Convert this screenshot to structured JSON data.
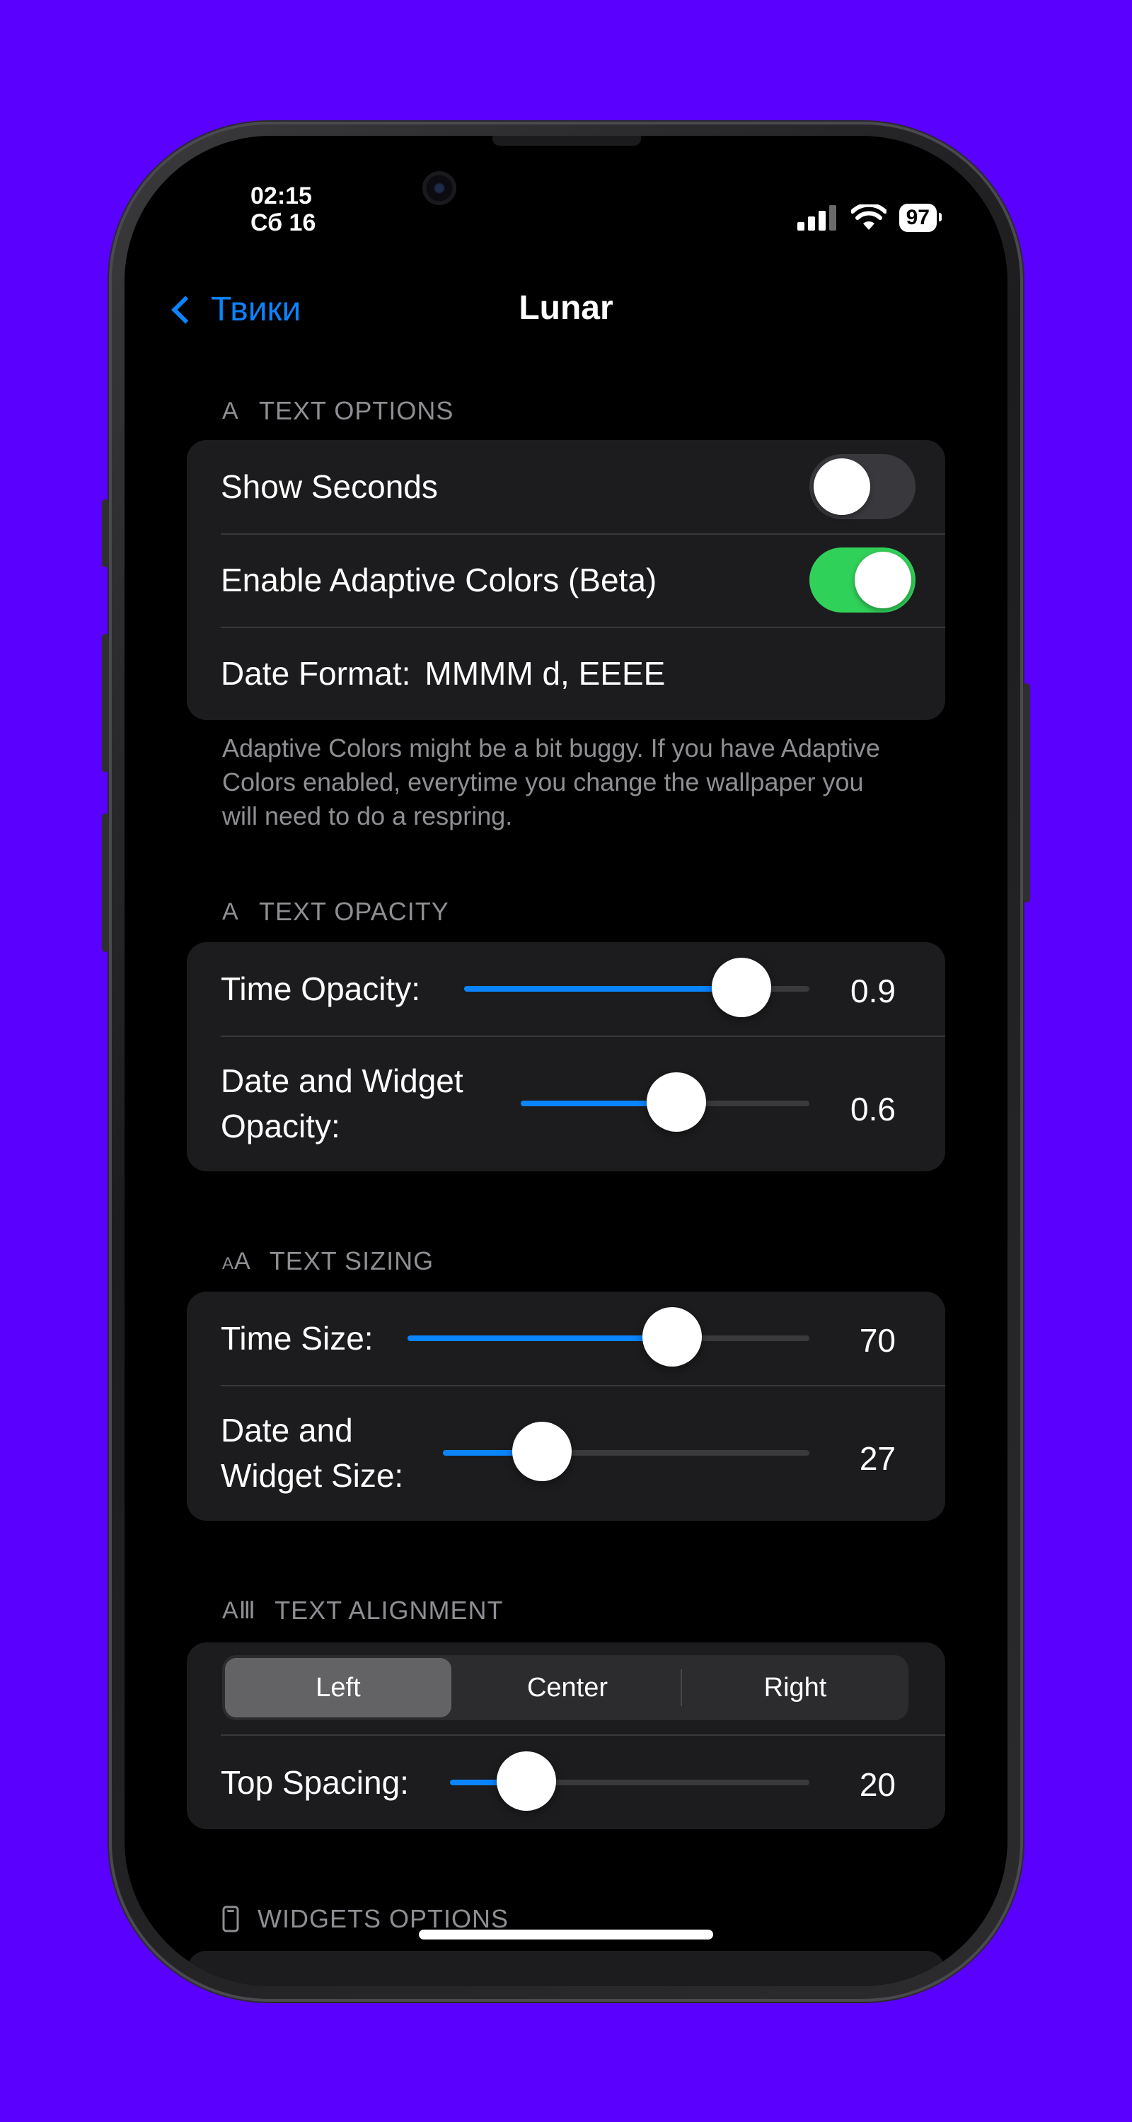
{
  "status": {
    "time": "02:15",
    "date": "Сб 16",
    "battery": "97"
  },
  "nav": {
    "back_label": "Твики",
    "title": "Lunar"
  },
  "text_options": {
    "header": "TEXT OPTIONS",
    "show_seconds": {
      "label": "Show Seconds",
      "on": false
    },
    "adaptive_colors": {
      "label": "Enable Adaptive Colors (Beta)",
      "on": true
    },
    "date_format": {
      "label": "Date Format:",
      "value": "MMMM d, EEEE"
    },
    "footer": "Adaptive Colors might be a bit buggy. If you have Adaptive Colors enabled, everytime you change the wallpaper you will need to do a respring."
  },
  "text_opacity": {
    "header": "TEXT OPACITY",
    "time": {
      "label": "Time Opacity:",
      "value": "0.9",
      "level": 0.9
    },
    "date_widget": {
      "label_line1": "Date and Widget",
      "label_line2": "Opacity:",
      "value": "0.6",
      "level": 0.6
    }
  },
  "text_sizing": {
    "header": "TEXT SIZING",
    "time": {
      "label": "Time Size:",
      "value": "70"
    },
    "date_widget": {
      "label_line1": "Date and",
      "label_line2": "Widget Size:",
      "value": "27"
    }
  },
  "text_alignment": {
    "header": "TEXT ALIGNMENT",
    "options": [
      "Left",
      "Center",
      "Right"
    ],
    "selected": "Left",
    "top_spacing": {
      "label": "Top Spacing:",
      "value": "20"
    }
  },
  "widgets_options": {
    "header": "WIDGETS OPTIONS"
  },
  "colors": {
    "accent": "#0a84ff",
    "toggle_on": "#30d158",
    "background": "#5a00ff"
  },
  "icons": [
    "chevron-left-icon",
    "signal-icon",
    "wifi-icon",
    "battery-icon",
    "text-a-icon",
    "text-size-icon",
    "text-cursor-icon",
    "phone-icon"
  ]
}
